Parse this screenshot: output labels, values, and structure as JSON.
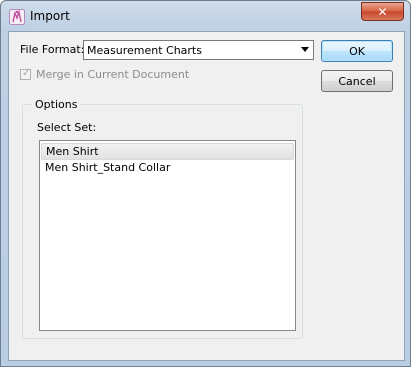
{
  "window": {
    "title": "Import",
    "close_glyph": "✕"
  },
  "file_format": {
    "label": "File Format:",
    "selected": "Measurement Charts"
  },
  "merge_checkbox": {
    "label": "Merge in Current Document",
    "checked": true,
    "enabled": false
  },
  "buttons": {
    "ok": "OK",
    "cancel": "Cancel"
  },
  "options": {
    "group_title": "Options",
    "select_set_label": "Select Set:",
    "items": [
      {
        "label": "Men Shirt",
        "selected": true
      },
      {
        "label": "Men Shirt_Stand Collar",
        "selected": false
      }
    ]
  },
  "colors": {
    "titlebar": "#bed0e4",
    "client_bg": "#f0f0f0",
    "close_button": "#c8442a",
    "default_button_border": "#3c7fb1"
  },
  "icons": {
    "app": "app-logo-icon",
    "close": "close-icon",
    "dropdown": "chevron-down-icon",
    "check": "checkmark-icon"
  }
}
